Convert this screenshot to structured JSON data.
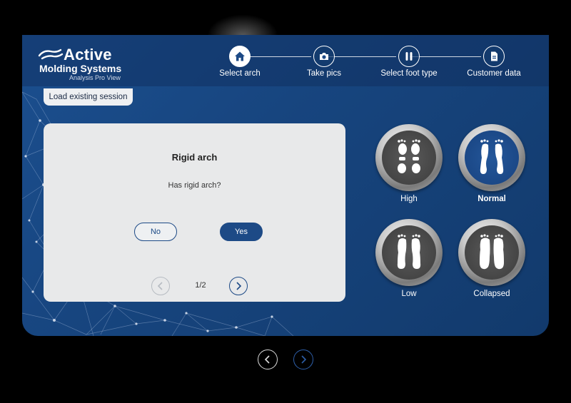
{
  "brand": {
    "line1": "Active",
    "line2": "Molding Systems",
    "line3": "Analysis Pro View"
  },
  "steps": [
    {
      "label": "Select arch",
      "icon": "home-icon",
      "active": true
    },
    {
      "label": "Take pics",
      "icon": "camera-icon",
      "active": false
    },
    {
      "label": "Select foot type",
      "icon": "footprints-icon",
      "active": false
    },
    {
      "label": "Customer data",
      "icon": "document-icon",
      "active": false
    }
  ],
  "session": {
    "load_label": "Load existing session"
  },
  "question_card": {
    "title": "Rigid arch",
    "question": "Has rigid arch?",
    "no_label": "No",
    "yes_label": "Yes",
    "page_counter": "1/2"
  },
  "arch_options": [
    {
      "label": "High",
      "selected": false
    },
    {
      "label": "Normal",
      "selected": true
    },
    {
      "label": "Low",
      "selected": false
    },
    {
      "label": "Collapsed",
      "selected": false
    }
  ],
  "colors": {
    "background": "#000000",
    "panel": "#1b4f8f",
    "accent": "#1d4a86",
    "card": "#e8e9ea"
  }
}
